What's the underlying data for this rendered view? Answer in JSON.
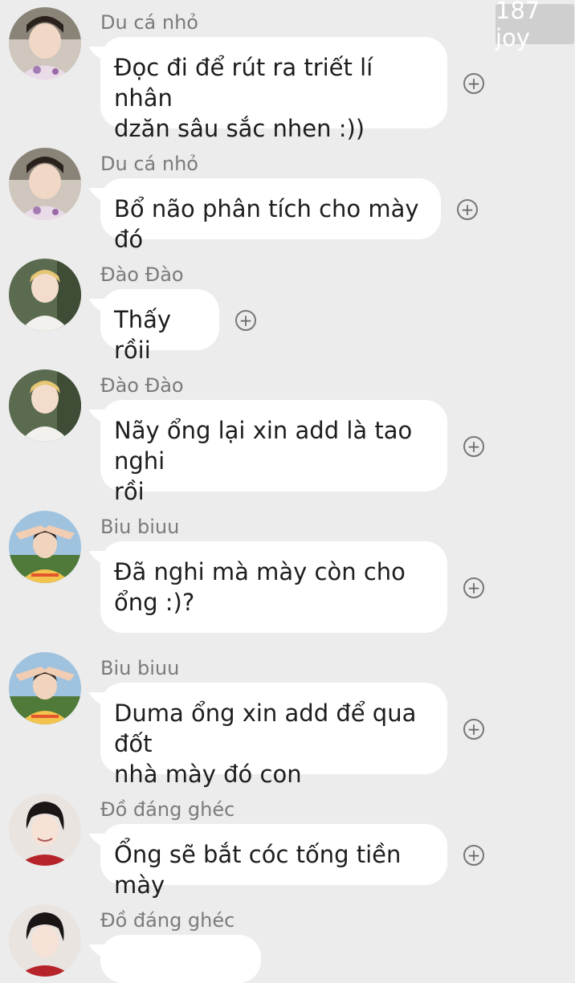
{
  "watermark": "187 joy",
  "messages": [
    {
      "sender": "Du cá nhỏ",
      "avatar": "avatar-du-ca-nho",
      "lines": [
        "Đọc đi để rút ra triết lí nhân",
        "dzăn sâu sắc nhen :))"
      ]
    },
    {
      "sender": "Du cá nhỏ",
      "avatar": "avatar-du-ca-nho",
      "lines": [
        "Bổ não phân tích cho mày đó"
      ]
    },
    {
      "sender": "Đào Đào",
      "avatar": "avatar-dao-dao",
      "lines": [
        "Thấy rồii"
      ]
    },
    {
      "sender": "Đào Đào",
      "avatar": "avatar-dao-dao",
      "lines": [
        "Nãy ổng lại xin add là tao nghi",
        "rồi"
      ]
    },
    {
      "sender": "Biu biuu",
      "avatar": "avatar-biu-biuu",
      "lines": [
        "Đã nghi mà mày còn cho",
        "ổng :)?"
      ]
    },
    {
      "sender": "Biu biuu",
      "avatar": "avatar-biu-biuu",
      "lines": [
        "Duma ổng xin add để qua đốt",
        "nhà mày đó con"
      ]
    },
    {
      "sender": "Đồ đáng ghéc",
      "avatar": "avatar-do-dang-ghec",
      "lines": [
        "Ổng sẽ bắt cóc tống tiền mày"
      ]
    },
    {
      "sender": "Đồ đáng ghéc",
      "avatar": "avatar-do-dang-ghec",
      "lines": []
    }
  ],
  "react_icon": "add-reaction-icon"
}
